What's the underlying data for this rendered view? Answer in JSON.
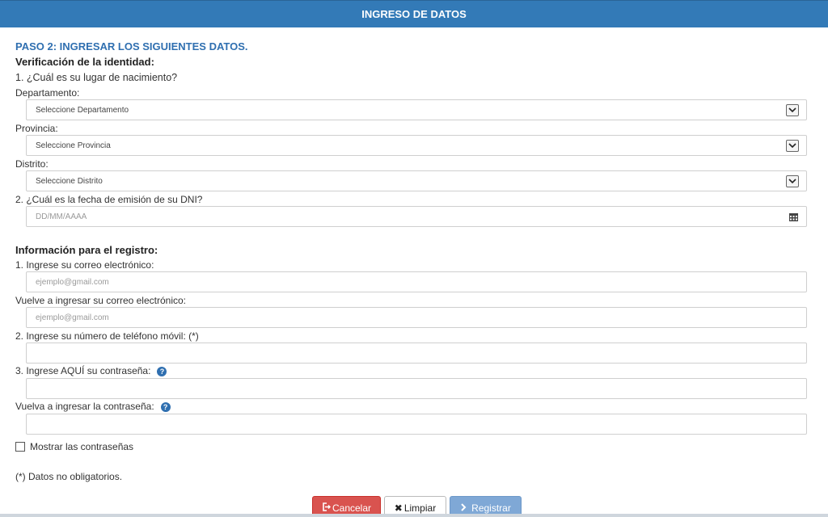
{
  "header": {
    "title": "INGRESO DE DATOS"
  },
  "step_title": "PASO 2: INGRESAR LOS SIGUIENTES DATOS.",
  "identity": {
    "title": "Verificación de la identidad:",
    "q1": "1. ¿Cuál es su lugar de nacimiento?",
    "departamento": {
      "label": "Departamento:",
      "value": "Seleccione Departamento"
    },
    "provincia": {
      "label": "Provincia:",
      "value": "Seleccione Provincia"
    },
    "distrito": {
      "label": "Distrito:",
      "value": "Seleccione Distrito"
    },
    "q2": "2. ¿Cuál es la fecha de emisión de su DNI?",
    "fecha": {
      "placeholder": "DD/MM/AAAA"
    }
  },
  "registro": {
    "title": "Información para el registro:",
    "email": {
      "label": "1. Ingrese su correo electrónico:",
      "placeholder": "ejemplo@gmail.com"
    },
    "email_confirm": {
      "label": "Vuelve a ingresar su correo electrónico:",
      "placeholder": "ejemplo@gmail.com"
    },
    "telefono": {
      "label": "2. Ingrese su número de teléfono móvil: (*)",
      "value": ""
    },
    "password": {
      "label": "3. Ingrese AQUÍ su contraseña:",
      "value": ""
    },
    "password_confirm": {
      "label": "Vuelva a ingresar la contraseña:",
      "value": ""
    },
    "show_passwords": {
      "label": "Mostrar las contraseñas",
      "checked": false
    },
    "note": "(*) Datos no obligatorios."
  },
  "buttons": {
    "cancel": "Cancelar",
    "clear": "Limpiar",
    "register": "Registrar"
  },
  "icons": {
    "help": "question-circle-icon",
    "calendar": "calendar-icon",
    "dropdown": "chevron-down-icon"
  },
  "colors": {
    "header": "#337ab7",
    "accent_text": "#2f6fb0",
    "cancel": "#d9534f",
    "register": "#7fa8d6"
  }
}
